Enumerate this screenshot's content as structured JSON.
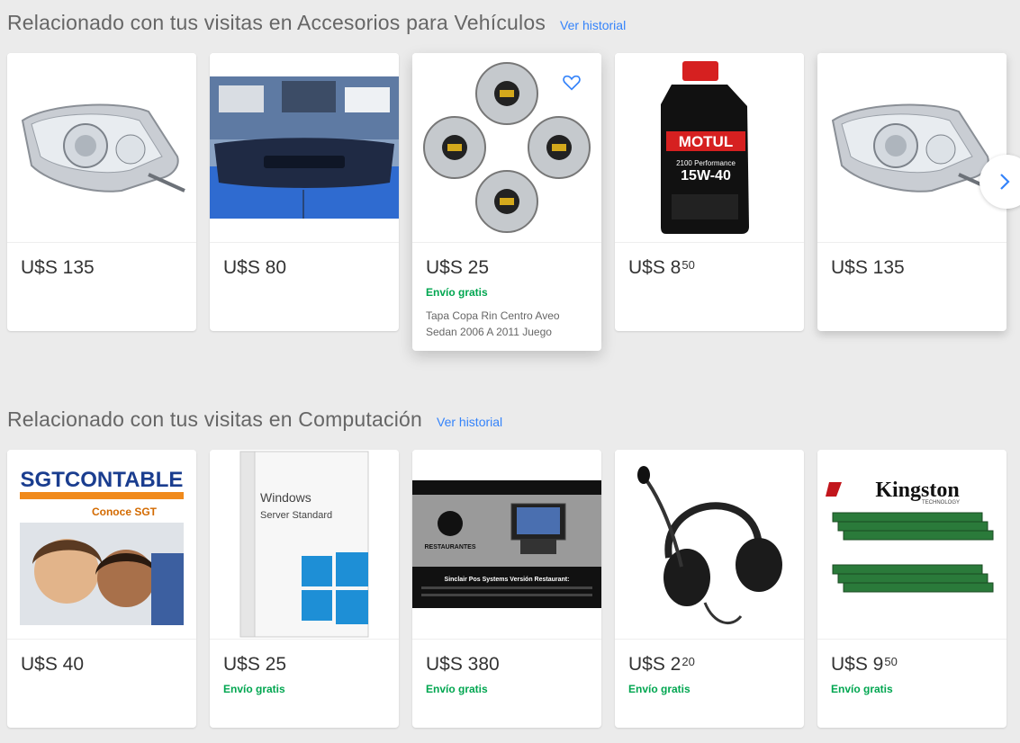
{
  "sections": [
    {
      "title": "Relacionado con tus visitas en Accesorios para Vehículos",
      "link": "Ver historial",
      "items": [
        {
          "icon": "headlight-image",
          "price_int": "U$S 135",
          "price_cents": "",
          "shipping": "",
          "description": ""
        },
        {
          "icon": "bumper-image",
          "price_int": "U$S 80",
          "price_cents": "",
          "shipping": "",
          "description": ""
        },
        {
          "icon": "hubcaps-image",
          "price_int": "U$S 25",
          "price_cents": "",
          "shipping": "Envío gratis",
          "description": "Tapa Copa Rin Centro Aveo Sedan 2006 A 2011 Juego"
        },
        {
          "icon": "motor-oil-image",
          "price_int": "U$S 8",
          "price_cents": "50",
          "shipping": "",
          "description": "",
          "label_brand": "MOTUL",
          "label_line": "2100 Performance",
          "label_grade": "15W-40"
        },
        {
          "icon": "headlight-image",
          "price_int": "U$S 135",
          "price_cents": "",
          "shipping": "",
          "description": ""
        }
      ]
    },
    {
      "title": "Relacionado con tus visitas en Computación",
      "link": "Ver historial",
      "items": [
        {
          "icon": "software-box-image",
          "price_int": "U$S 40",
          "price_cents": "",
          "shipping": "",
          "description": "",
          "label_a": "SGTCONTABLE",
          "label_b": "Conoce SGT"
        },
        {
          "icon": "windows-server-box-image",
          "price_int": "U$S 25",
          "price_cents": "",
          "shipping": "Envío gratis",
          "description": "",
          "label_a": "Windows",
          "label_b": "Server Standard"
        },
        {
          "icon": "pos-system-image",
          "price_int": "U$S 380",
          "price_cents": "",
          "shipping": "Envío gratis",
          "description": "",
          "label_a": "RESTAURANTES",
          "label_b": "Sinclair Pos Systems Versión Restaurant:"
        },
        {
          "icon": "headset-image",
          "price_int": "U$S 2",
          "price_cents": "20",
          "shipping": "Envío gratis",
          "description": ""
        },
        {
          "icon": "ram-memory-image",
          "price_int": "U$S 9",
          "price_cents": "50",
          "shipping": "Envío gratis",
          "description": "",
          "label_a": "Kingston",
          "label_b": "TECHNOLOGY"
        }
      ]
    }
  ],
  "colors": {
    "accent": "#3483fa",
    "shipping": "#00a650",
    "background": "#ebebeb"
  },
  "carousel": {
    "next_icon": "chevron-right-icon"
  }
}
